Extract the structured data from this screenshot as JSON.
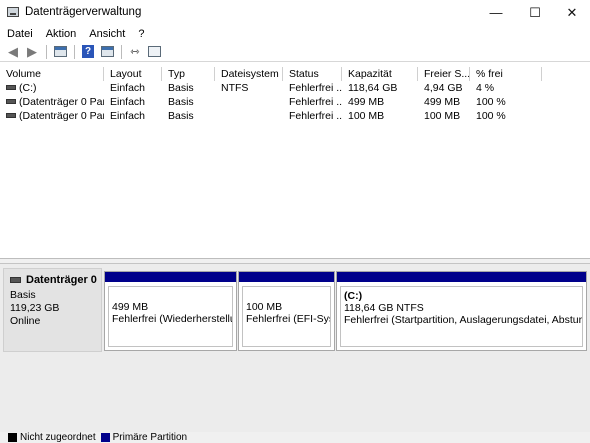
{
  "window": {
    "title": "Datenträgerverwaltung",
    "controls": {
      "minimize": "—",
      "maximize": "☐",
      "close": "✕"
    }
  },
  "menu": [
    "Datei",
    "Aktion",
    "Ansicht",
    "?"
  ],
  "toolbar": {
    "icons": [
      "back-arrow-icon",
      "forward-arrow-icon",
      "properties-icon",
      "help-icon",
      "console-icon",
      "connect-icon",
      "settings-icon"
    ]
  },
  "volume_list": {
    "columns": [
      "Volume",
      "Layout",
      "Typ",
      "Dateisystem",
      "Status",
      "Kapazität",
      "Freier S...",
      "% frei"
    ],
    "rows": [
      [
        "(C:)",
        "Einfach",
        "Basis",
        "NTFS",
        "Fehlerfrei ...",
        "118,64 GB",
        "4,94 GB",
        "4 %"
      ],
      [
        "(Datenträger 0 Par...",
        "Einfach",
        "Basis",
        "",
        "Fehlerfrei ...",
        "499 MB",
        "499 MB",
        "100 %"
      ],
      [
        "(Datenträger 0 Par...",
        "Einfach",
        "Basis",
        "",
        "Fehlerfrei ...",
        "100 MB",
        "100 MB",
        "100 %"
      ]
    ]
  },
  "disk": {
    "name": "Datenträger 0",
    "type": "Basis",
    "size": "119,23 GB",
    "state": "Online",
    "partitions": [
      {
        "label": "",
        "size": "499 MB",
        "status": "Fehlerfrei (Wiederherstellungspartition)"
      },
      {
        "label": "",
        "size": "100 MB",
        "status": "Fehlerfrei (EFI-Systempartition)"
      },
      {
        "label": "(C:)",
        "size": "118,64 GB NTFS",
        "status": "Fehlerfrei (Startpartition, Auslagerungsdatei, Absturzabbild, Standarddatenpartition)"
      }
    ]
  },
  "legend": [
    {
      "label": "Nicht zugeordnet",
      "color": "#000000"
    },
    {
      "label": "Primäre Partition",
      "color": "#00008b"
    }
  ]
}
